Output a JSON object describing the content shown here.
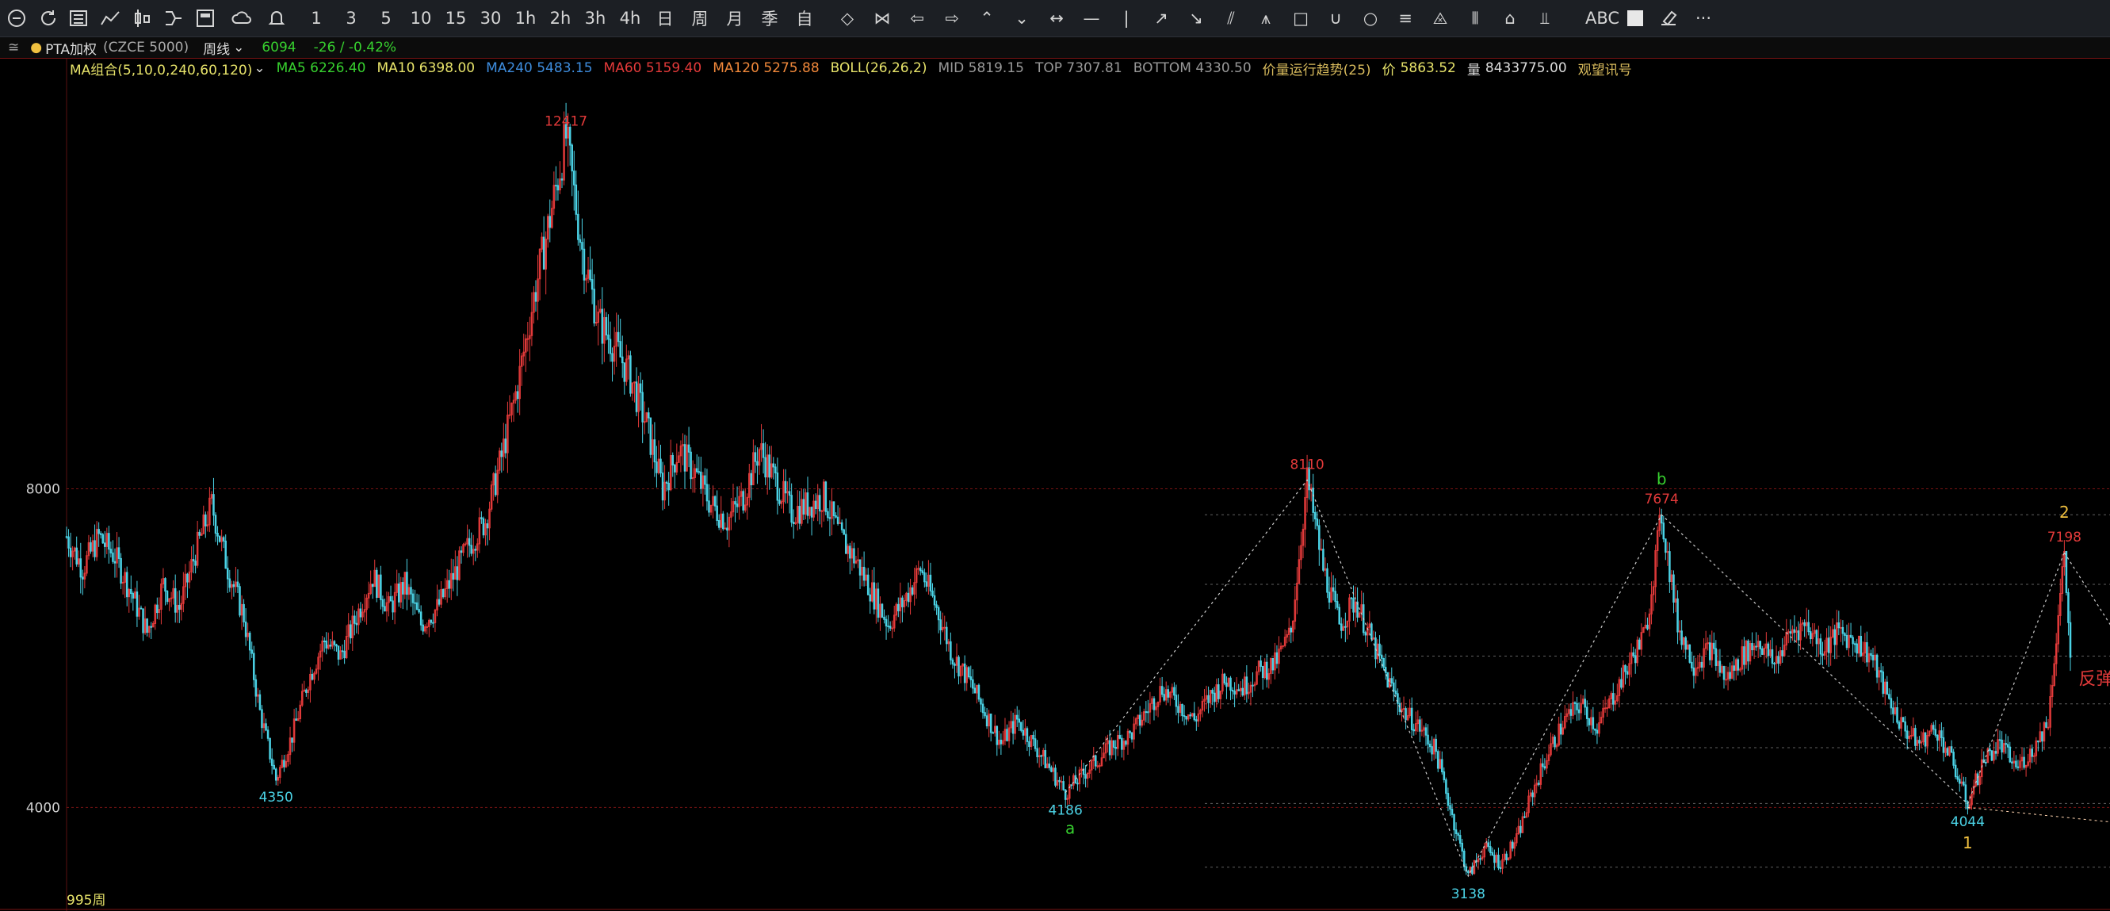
{
  "toolbar": {
    "period_buttons": [
      "1",
      "3",
      "5",
      "10",
      "15",
      "30",
      "1h",
      "2h",
      "3h",
      "4h",
      "日",
      "周",
      "月",
      "季",
      "自"
    ],
    "icons": [
      "menu-icon",
      "refresh-icon",
      "list-icon",
      "line-chart-icon",
      "candle-icon",
      "fork-icon",
      "window-icon",
      "cloud-icon",
      "bell-icon"
    ],
    "draw_icons": [
      "expand-icon",
      "collapse-icon",
      "arrow-left-icon",
      "arrow-right-icon",
      "double-up-icon",
      "double-down-icon",
      "width-icon",
      "hline-icon",
      "vline-icon",
      "ray-icon",
      "ray-down-icon",
      "parallel-icon",
      "wave-icon",
      "rect-icon",
      "arc-icon",
      "circle-icon",
      "fib-icon",
      "gann-icon",
      "bars-icon",
      "home-icon",
      "volume-icon"
    ],
    "abc_label": "ABC",
    "more_label": "···"
  },
  "infobar": {
    "symbol": "PTA加权",
    "exchange": "(CZCE 5000)",
    "period": "周线",
    "price": "6094",
    "change": "-26 / -0.42%"
  },
  "indicators": {
    "ma_group": "MA组合(5,10,0,240,60,120)",
    "ma5": "MA5 6226.40",
    "ma10": "MA10 6398.00",
    "ma240": "MA240 5483.15",
    "ma60": "MA60 5159.40",
    "ma120": "MA120 5275.88",
    "boll": "BOLL(26,26,2)",
    "mid": "MID 5819.15",
    "top": "TOP 7307.81",
    "bottom": "BOTTOM 4330.50",
    "trend": "价量运行趋势(25)",
    "price_label": "价",
    "price_value": "5863.52",
    "volume_label": "量",
    "volume_value": "8433775.00",
    "signal": "观望讯号"
  },
  "colors": {
    "up": "#e33a3a",
    "down": "#4bd3e6",
    "ma5": "#ffffff",
    "ma10": "#e7e36a",
    "ma240": "#3e8dde",
    "ma60": "#e33a3a",
    "ma120": "#f0883a",
    "green_text": "#37d12f"
  },
  "chart_data": {
    "type": "candlestick",
    "y_ticks": [
      "8000",
      "4000"
    ],
    "bar_count_label": "995周",
    "annotations": {
      "peaks": [
        {
          "label": "12417",
          "value": 12417
        },
        {
          "label": "8110",
          "value": 8110
        },
        {
          "label": "7674",
          "value": 7674
        },
        {
          "label": "7198",
          "value": 7198
        }
      ],
      "troughs": [
        {
          "label": "4350",
          "value": 4350
        },
        {
          "label": "4186",
          "value": 4186
        },
        {
          "label": "3138",
          "value": 3138
        },
        {
          "label": "4044",
          "value": 4044
        }
      ],
      "wave_labels": [
        "a",
        "b",
        "1",
        "2"
      ],
      "note": "反弹"
    },
    "series": [
      {
        "name": "PTA加权",
        "points": [
          [
            0,
            7400
          ],
          [
            8,
            7000
          ],
          [
            16,
            7400
          ],
          [
            24,
            7150
          ],
          [
            32,
            6700
          ],
          [
            40,
            6200
          ],
          [
            48,
            6800
          ],
          [
            56,
            6500
          ],
          [
            64,
            7200
          ],
          [
            72,
            7800
          ],
          [
            80,
            7000
          ],
          [
            88,
            6400
          ],
          [
            96,
            5200
          ],
          [
            104,
            4350
          ],
          [
            112,
            4900
          ],
          [
            120,
            5600
          ],
          [
            128,
            6100
          ],
          [
            136,
            5900
          ],
          [
            144,
            6400
          ],
          [
            152,
            6900
          ],
          [
            160,
            6500
          ],
          [
            168,
            6800
          ],
          [
            176,
            6300
          ],
          [
            184,
            6500
          ],
          [
            192,
            6900
          ],
          [
            200,
            7300
          ],
          [
            208,
            7600
          ],
          [
            216,
            8400
          ],
          [
            224,
            9300
          ],
          [
            232,
            10400
          ],
          [
            240,
            11400
          ],
          [
            248,
            12417
          ],
          [
            256,
            11000
          ],
          [
            264,
            10100
          ],
          [
            272,
            9800
          ],
          [
            280,
            9400
          ],
          [
            288,
            8800
          ],
          [
            296,
            8000
          ],
          [
            304,
            8500
          ],
          [
            312,
            8200
          ],
          [
            320,
            7800
          ],
          [
            328,
            7600
          ],
          [
            336,
            7900
          ],
          [
            344,
            8500
          ],
          [
            352,
            8100
          ],
          [
            360,
            7700
          ],
          [
            368,
            7800
          ],
          [
            376,
            7900
          ],
          [
            384,
            7400
          ],
          [
            392,
            7100
          ],
          [
            400,
            6700
          ],
          [
            408,
            6300
          ],
          [
            416,
            6600
          ],
          [
            424,
            7000
          ],
          [
            432,
            6500
          ],
          [
            440,
            5900
          ],
          [
            448,
            5600
          ],
          [
            456,
            5200
          ],
          [
            464,
            4800
          ],
          [
            472,
            5100
          ],
          [
            480,
            4800
          ],
          [
            488,
            4500
          ],
          [
            496,
            4186
          ],
          [
            504,
            4400
          ],
          [
            512,
            4600
          ],
          [
            520,
            4800
          ],
          [
            528,
            4900
          ],
          [
            536,
            5200
          ],
          [
            544,
            5500
          ],
          [
            552,
            5300
          ],
          [
            560,
            5100
          ],
          [
            568,
            5400
          ],
          [
            576,
            5600
          ],
          [
            584,
            5500
          ],
          [
            592,
            5700
          ],
          [
            600,
            5800
          ],
          [
            608,
            6200
          ],
          [
            616,
            8110
          ],
          [
            624,
            7000
          ],
          [
            632,
            6300
          ],
          [
            640,
            6600
          ],
          [
            648,
            6100
          ],
          [
            656,
            5600
          ],
          [
            664,
            5200
          ],
          [
            672,
            5000
          ],
          [
            680,
            4700
          ],
          [
            688,
            3900
          ],
          [
            696,
            3138
          ],
          [
            704,
            3500
          ],
          [
            712,
            3300
          ],
          [
            720,
            3600
          ],
          [
            728,
            4200
          ],
          [
            736,
            4700
          ],
          [
            744,
            5100
          ],
          [
            752,
            5300
          ],
          [
            760,
            5000
          ],
          [
            768,
            5400
          ],
          [
            776,
            5800
          ],
          [
            784,
            6200
          ],
          [
            792,
            7674
          ],
          [
            800,
            6300
          ],
          [
            808,
            5800
          ],
          [
            816,
            6000
          ],
          [
            824,
            5600
          ],
          [
            832,
            5900
          ],
          [
            840,
            6100
          ],
          [
            848,
            5800
          ],
          [
            856,
            6200
          ],
          [
            864,
            6300
          ],
          [
            872,
            6000
          ],
          [
            880,
            6200
          ],
          [
            888,
            6100
          ],
          [
            896,
            5900
          ],
          [
            904,
            5400
          ],
          [
            912,
            5000
          ],
          [
            920,
            4800
          ],
          [
            928,
            5000
          ],
          [
            936,
            4600
          ],
          [
            944,
            4044
          ],
          [
            952,
            4600
          ],
          [
            960,
            4800
          ],
          [
            968,
            4500
          ],
          [
            976,
            4700
          ],
          [
            984,
            5100
          ],
          [
            992,
            7198
          ],
          [
            995,
            5863
          ]
        ]
      }
    ]
  }
}
